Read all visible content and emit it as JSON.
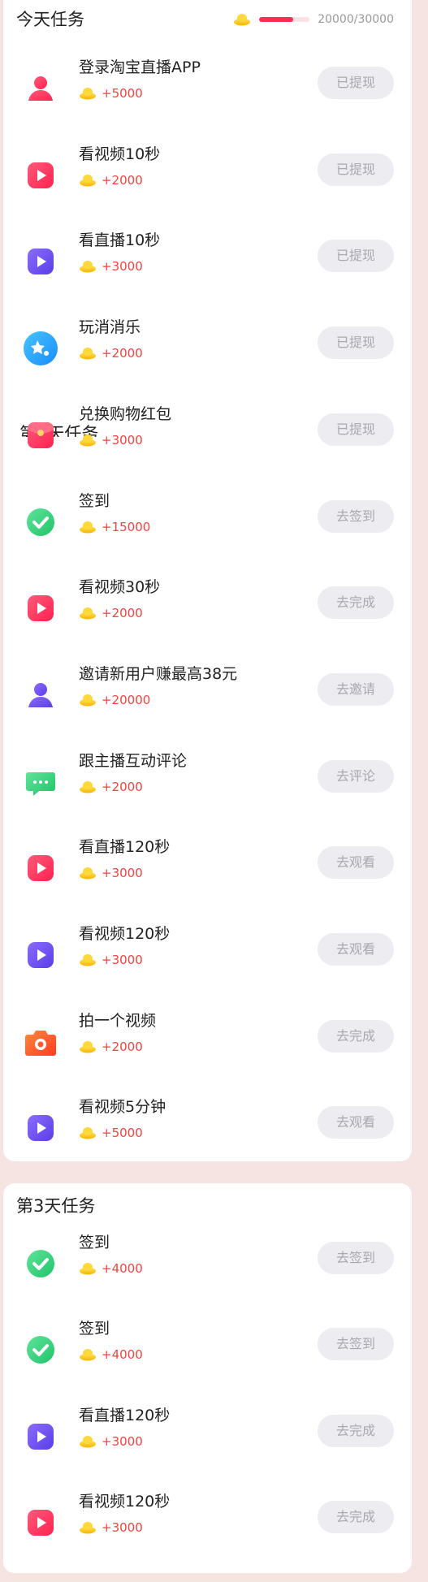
{
  "day1": {
    "title": "今天任务",
    "progress_text": "20000/30000",
    "progress_fraction": 0.667
  },
  "day2": {
    "title": "第2天任务"
  },
  "day3": {
    "title": "第3天任务"
  },
  "tasks": [
    {
      "name": "登录淘宝直播APP",
      "reward": "+5000",
      "button": "已提现",
      "icon": "user-icon"
    },
    {
      "name": "看视频10秒",
      "reward": "+2000",
      "button": "已提现",
      "icon": "play-icon"
    },
    {
      "name": "看直播10秒",
      "reward": "+3000",
      "button": "已提现",
      "icon": "live-play-icon"
    },
    {
      "name": "玩消消乐",
      "reward": "+2000",
      "button": "已提现",
      "icon": "game-icon"
    },
    {
      "name": "兑换购物红包",
      "reward": "+3000",
      "button": "已提现",
      "icon": "red-packet-icon"
    },
    {
      "name": "签到",
      "reward": "+15000",
      "button": "去签到",
      "icon": "checkmark-icon"
    },
    {
      "name": "看视频30秒",
      "reward": "+2000",
      "button": "去完成",
      "icon": "play-icon"
    },
    {
      "name": "邀请新用户赚最高38元",
      "reward": "+20000",
      "button": "去邀请",
      "icon": "invite-user-icon"
    },
    {
      "name": "跟主播互动评论",
      "reward": "+2000",
      "button": "去评论",
      "icon": "comment-icon"
    },
    {
      "name": "看直播120秒",
      "reward": "+3000",
      "button": "去观看",
      "icon": "play-icon"
    },
    {
      "name": "看视频120秒",
      "reward": "+3000",
      "button": "去观看",
      "icon": "live-play-icon"
    },
    {
      "name": "拍一个视频",
      "reward": "+2000",
      "button": "去完成",
      "icon": "camera-icon"
    },
    {
      "name": "看视频5分钟",
      "reward": "+5000",
      "button": "去观看",
      "icon": "live-play-icon"
    },
    {
      "name": "签到",
      "reward": "+4000",
      "button": "去签到",
      "icon": "checkmark-icon"
    },
    {
      "name": "签到",
      "reward": "+4000",
      "button": "去签到",
      "icon": "checkmark-icon"
    },
    {
      "name": "看直播120秒",
      "reward": "+3000",
      "button": "去完成",
      "icon": "live-play-icon"
    },
    {
      "name": "看视频120秒",
      "reward": "+3000",
      "button": "去完成",
      "icon": "play-icon"
    }
  ],
  "colors": {
    "accent": "#ff2d55",
    "reward_text": "#f7423e",
    "button_bg": "#ececf1",
    "button_text": "#a8a8b0",
    "page_bg": "#f6e4e2"
  }
}
